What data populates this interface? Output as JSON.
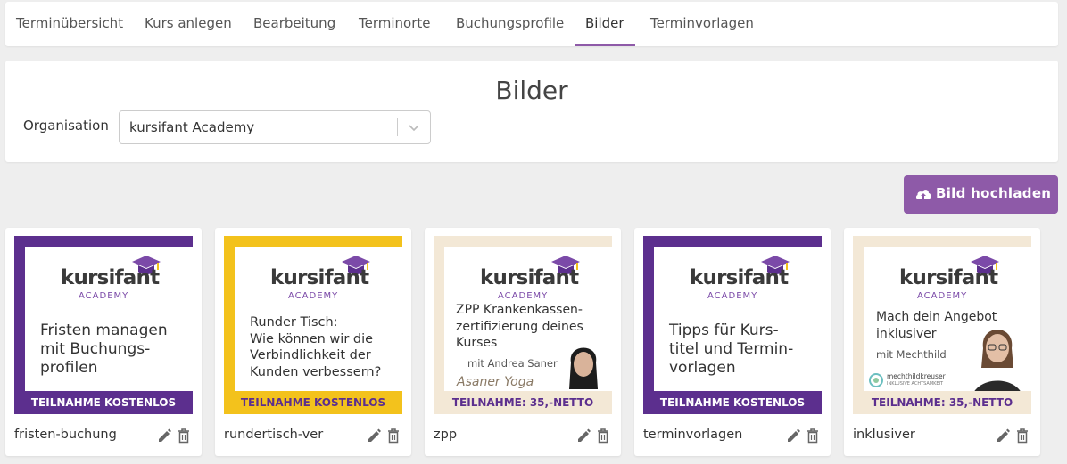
{
  "tabs": [
    {
      "label": "Terminübersicht",
      "active": false
    },
    {
      "label": "Kurs anlegen",
      "active": false
    },
    {
      "label": "Bearbeitung",
      "active": false
    },
    {
      "label": "Terminorte",
      "active": false
    },
    {
      "label": "Buchungsprofile",
      "active": false
    },
    {
      "label": "Bilder",
      "active": true
    },
    {
      "label": "Terminvorlagen",
      "active": false
    }
  ],
  "page": {
    "title": "Bilder",
    "organisation_label": "Organisation",
    "organisation_value": "kursifant Academy",
    "upload_label": "Bild hochladen"
  },
  "colors": {
    "accent": "#8e5aa8",
    "purple_frame": "#5c2f8e",
    "yellow_frame": "#f3c21c",
    "cream_frame": "#f3e8d6"
  },
  "images": [
    {
      "name": "fristen-buchung",
      "logo": "kursifant",
      "logo_sub": "ACADEMY",
      "title_lines": [
        "Fristen managen",
        "mit Buchungs-",
        "profilen"
      ],
      "footer": "TEILNAHME KOSTENLOS",
      "theme": "purple"
    },
    {
      "name": "rundertisch-ver",
      "logo": "kursifant",
      "logo_sub": "ACADEMY",
      "title_lines": [
        "Runder Tisch:",
        "Wie können wir die",
        "Verbindlichkeit der",
        "Kunden verbessern?"
      ],
      "footer": "TEILNAHME KOSTENLOS",
      "theme": "yellow"
    },
    {
      "name": "zpp",
      "logo": "kursifant",
      "logo_sub": "ACADEMY",
      "title_lines": [
        "ZPP Krankenkassen-",
        "zertifizierung deines",
        "Kurses"
      ],
      "subtitle": "mit Andrea Saner",
      "brand": "Asaner Yoga",
      "footer": "TEILNAHME: 35,-NETTO",
      "theme": "cream"
    },
    {
      "name": "terminvorlagen",
      "logo": "kursifant",
      "logo_sub": "ACADEMY",
      "title_lines": [
        "Tipps für Kurs-",
        "titel und Termin-",
        "vorlagen"
      ],
      "footer": "TEILNAHME KOSTENLOS",
      "theme": "purple"
    },
    {
      "name": "inklusiver",
      "logo": "kursifant",
      "logo_sub": "ACADEMY",
      "title_lines": [
        "Mach dein Angebot",
        "inklusiver"
      ],
      "subtitle": "mit Mechthild",
      "brand_top": "mechthildkreuser",
      "brand_bottom": "INKLUSIVE ACHTSAMKEIT",
      "footer": "TEILNAHME: 35,-NETTO",
      "theme": "cream"
    }
  ],
  "icons": {
    "upload": "cloud-upload-icon",
    "edit": "pencil-icon",
    "delete": "trash-icon",
    "dropdown": "chevron-down-icon"
  }
}
